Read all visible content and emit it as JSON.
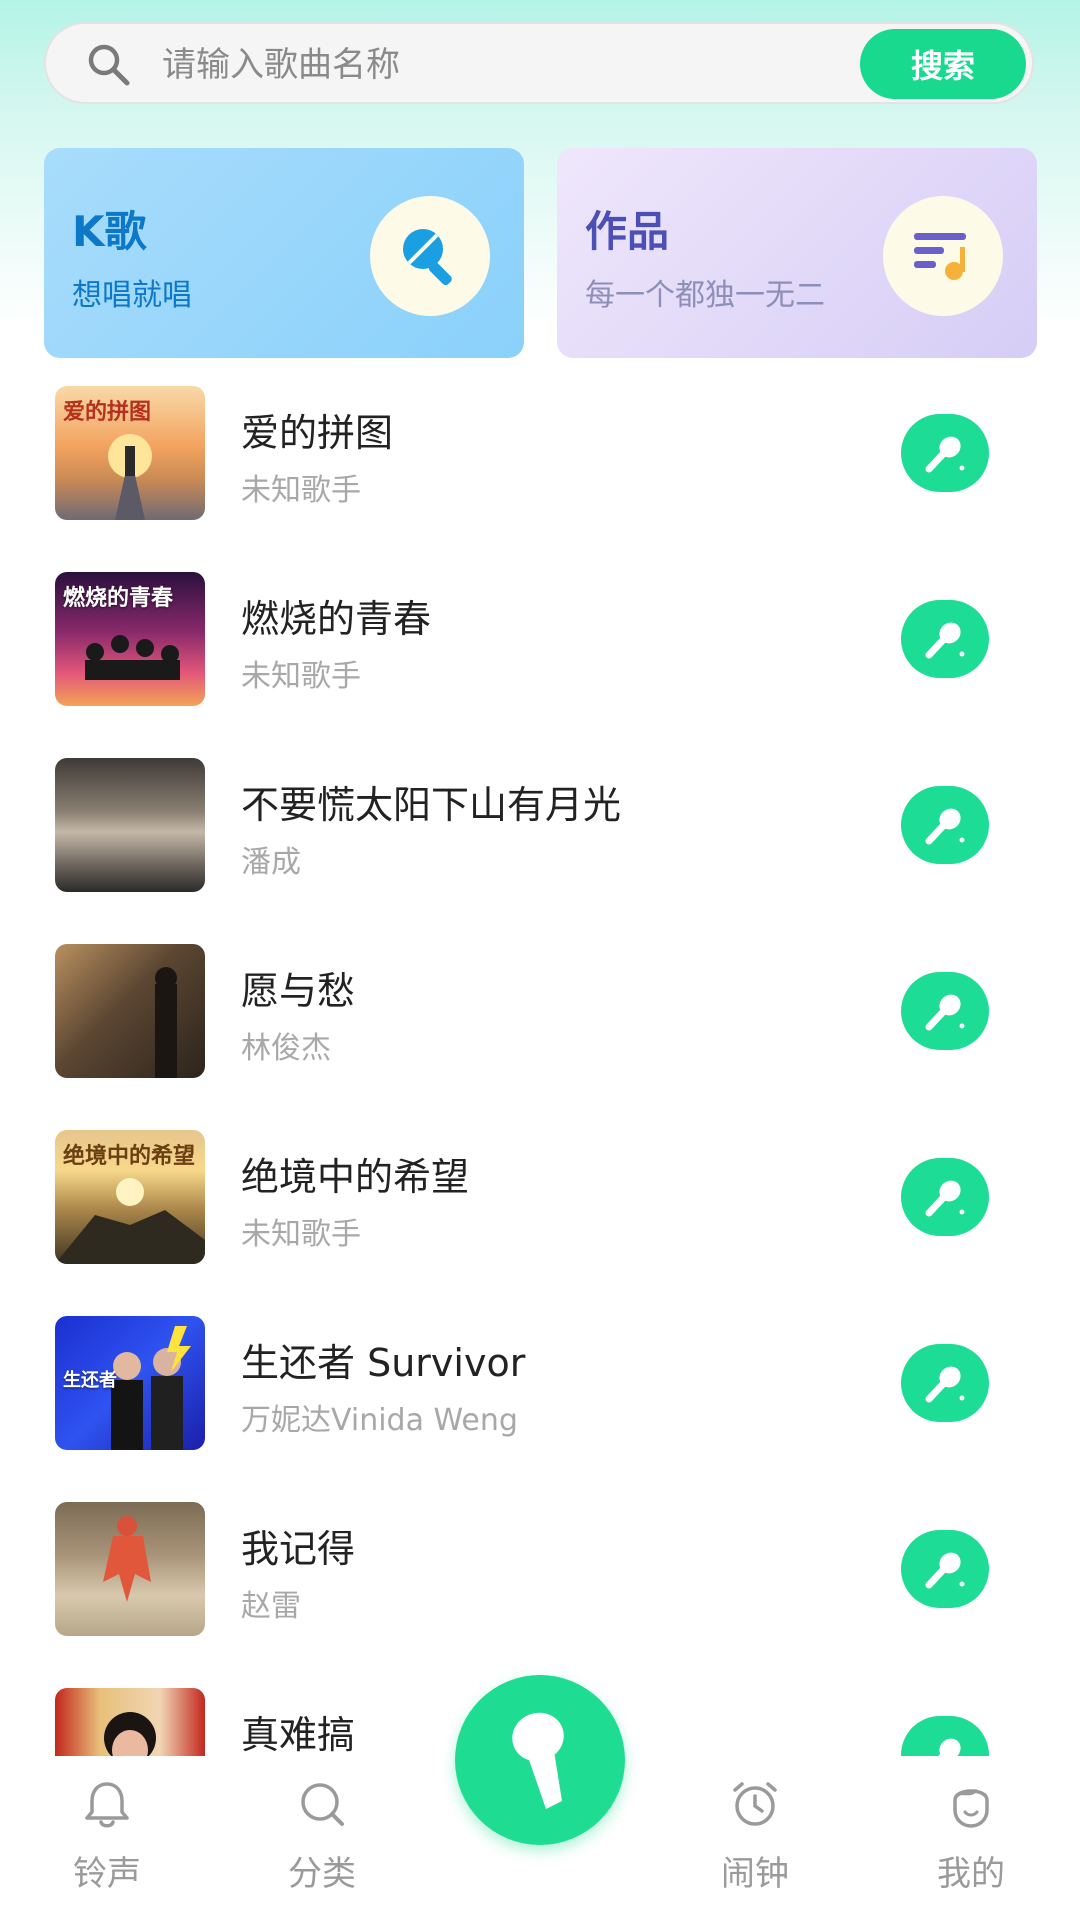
{
  "search": {
    "placeholder": "请输入歌曲名称",
    "button_label": "搜索"
  },
  "cards": [
    {
      "title": "K歌",
      "subtitle": "想唱就唱",
      "icon": "microphone-icon"
    },
    {
      "title": "作品",
      "subtitle": "每一个都独一无二",
      "icon": "music-list-icon"
    }
  ],
  "songs": [
    {
      "title": "爱的拼图",
      "artist": "未知歌手",
      "cover_text": "爱的拼图"
    },
    {
      "title": "燃烧的青春",
      "artist": "未知歌手",
      "cover_text": "燃烧的青春"
    },
    {
      "title": "不要慌太阳下山有月光",
      "artist": "潘成",
      "cover_text": ""
    },
    {
      "title": "愿与愁",
      "artist": "林俊杰",
      "cover_text": ""
    },
    {
      "title": "绝境中的希望",
      "artist": "未知歌手",
      "cover_text": "绝境中的希望"
    },
    {
      "title": "生还者 Survivor",
      "artist": "万妮达Vinida Weng",
      "cover_text": "生还者"
    },
    {
      "title": "我记得",
      "artist": "赵雷",
      "cover_text": ""
    },
    {
      "title": "真难搞",
      "artist": "",
      "cover_text": ""
    }
  ],
  "nav": [
    {
      "label": "铃声",
      "icon": "bell-icon"
    },
    {
      "label": "分类",
      "icon": "search-icon"
    },
    {
      "label": "闹钟",
      "icon": "alarm-clock-icon"
    },
    {
      "label": "我的",
      "icon": "profile-icon"
    }
  ],
  "colors": {
    "accent": "#1ddc95",
    "card_blue": "#8ad1fb",
    "card_purple": "#d6cdf6"
  }
}
